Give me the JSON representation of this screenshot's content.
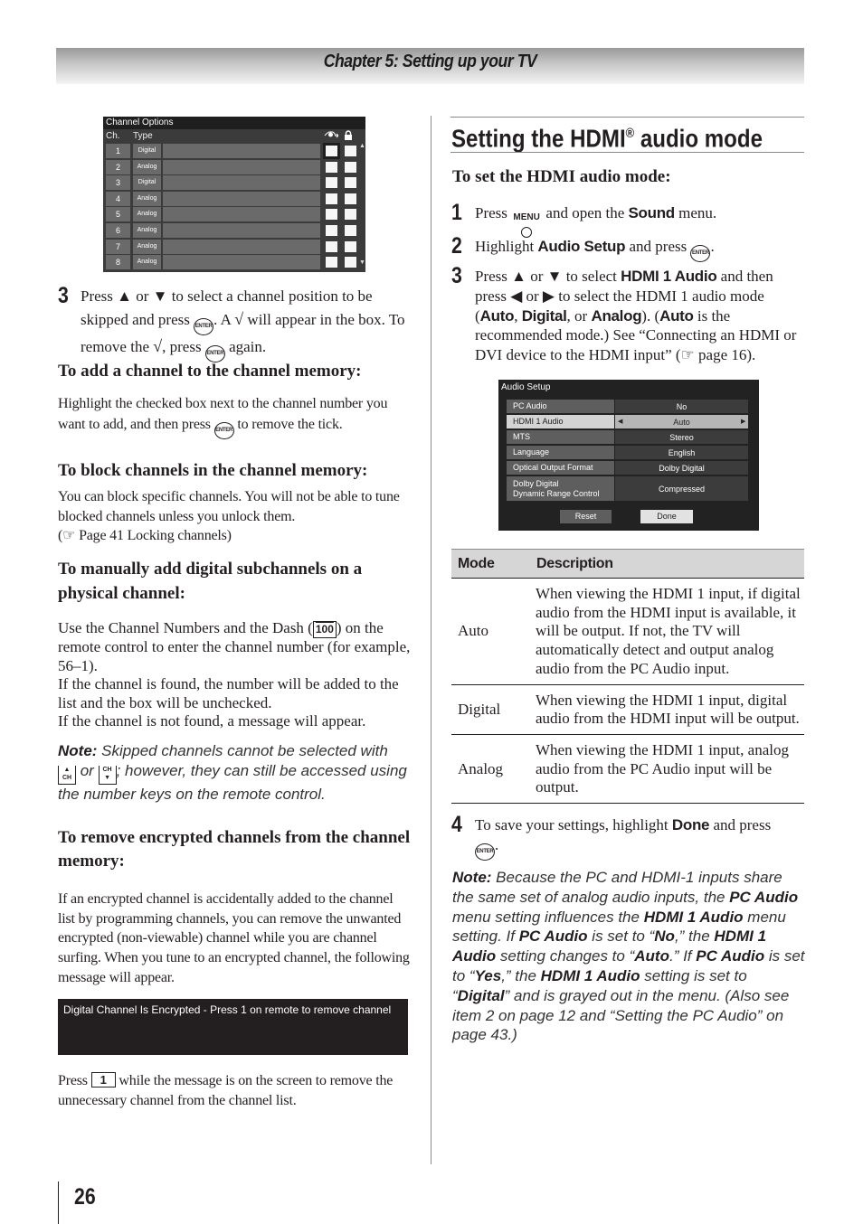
{
  "header": {
    "chapter_title": "Chapter 5: Setting up your TV"
  },
  "left": {
    "channel_options_screen": {
      "title": "Channel Options",
      "col_ch": "Ch.",
      "col_type": "Type",
      "skip_icon": "skip-eye-icon",
      "lock_icon": "lock-icon",
      "rows": [
        {
          "ch": "1",
          "type": "Digital",
          "skip_selected": true
        },
        {
          "ch": "2",
          "type": "Analog",
          "skip_selected": false
        },
        {
          "ch": "3",
          "type": "Digital",
          "skip_selected": false
        },
        {
          "ch": "4",
          "type": "Analog",
          "skip_selected": false
        },
        {
          "ch": "5",
          "type": "Analog",
          "skip_selected": false
        },
        {
          "ch": "6",
          "type": "Analog",
          "skip_selected": false
        },
        {
          "ch": "7",
          "type": "Analog",
          "skip_selected": false
        },
        {
          "ch": "8",
          "type": "Analog",
          "skip_selected": false
        }
      ],
      "scroll_up": "▲",
      "scroll_down": "▼"
    },
    "step3": {
      "num": "3",
      "p1": "Press ▲ or ▼ to select a channel position to be skipped and press ",
      "p2": ". A ",
      "p3": " will appear in the box. To remove the ",
      "p4": ", press ",
      "p5": " again.",
      "check": "√",
      "enter": "ENTER"
    },
    "add_heading": "To add a channel to the channel memory:",
    "add_body_1": "Highlight the checked box next to the channel number you want to add, and then press ",
    "add_body_2": " to remove the tick.",
    "block_heading": "To block channels in the channel memory:",
    "block_body": "You can block specific channels. You will not be able to tune blocked channels unless you unlock them.",
    "block_ref": "(☞ Page 41 Locking channels)",
    "manual_heading": "To manually add digital subchannels on a physical channel:",
    "manual_body_1": "Use the Channel Numbers and the Dash (",
    "dash_key": "100",
    "manual_body_2": ") on the remote control to enter the channel number (for example, 56–1).",
    "manual_body_3": "If the channel is found, the number will be added to the list and the box will be unchecked.",
    "manual_body_4": "If the channel is not found, a message will appear.",
    "note1_label": "Note:",
    "note1_1": " Skipped channels cannot be selected with ",
    "note1_or": " or ",
    "note1_2": "; however, they can still be accessed using the number keys on the remote control.",
    "ch_up_key": "CH",
    "ch_down_key": "CH",
    "remove_heading": "To remove encrypted channels from the channel memory:",
    "remove_body": "If an encrypted channel is accidentally added to the channel list by programming channels, you can remove the unwanted encrypted (non-viewable) channel while you are channel surfing. When you tune to an encrypted channel, the following message will appear.",
    "encrypted_message": "Digital Channel Is Encrypted - Press 1 on remote to remove channel",
    "press_1_a": "Press ",
    "key_1": "1",
    "press_1_b": " while the message is on the screen to remove the unnecessary channel from the channel list."
  },
  "right": {
    "section_title": "Setting the HDMI",
    "section_title_reg": "®",
    "section_title_end": " audio mode",
    "sub_heading": "To set the HDMI audio mode:",
    "step1": {
      "num": "1",
      "a": "Press ",
      "menu_key": "MENU",
      "b": " and open the ",
      "bold": "Sound",
      "c": " menu."
    },
    "step2": {
      "num": "2",
      "a": "Highlight ",
      "bold": "Audio Setup",
      "b": " and press ",
      "c": "."
    },
    "step3": {
      "num": "3",
      "a": "Press ▲ or ▼ to select ",
      "b1": "HDMI 1 Audio",
      "c": " and then press ◀ or ▶ to select the HDMI 1 audio mode (",
      "b2": "Auto",
      "d": ", ",
      "b3": "Digital",
      "e": ", or ",
      "b4": "Analog",
      "f": "). (",
      "b5": "Auto",
      "g": " is the recommended mode.) See “Connecting an HDMI or DVI device to the HDMI input” (☞ page 16)."
    },
    "audio_setup_screen": {
      "title": "Audio Setup",
      "rows": [
        {
          "label": "PC Audio",
          "value": "No",
          "highlighted": false
        },
        {
          "label": "HDMI 1 Audio",
          "value": "Auto",
          "highlighted": true
        },
        {
          "label": "MTS",
          "value": "Stereo",
          "highlighted": false
        },
        {
          "label": "Language",
          "value": "English",
          "highlighted": false
        },
        {
          "label": "Optical Output Format",
          "value": "Dolby Digital",
          "highlighted": false
        },
        {
          "label": "Dolby Digital\nDynamic Range Control",
          "value": "Compressed",
          "highlighted": false
        }
      ],
      "left_arrow": "◀",
      "right_arrow": "▶",
      "reset_label": "Reset",
      "done_label": "Done"
    },
    "mode_table": {
      "headers": [
        "Mode",
        "Description"
      ],
      "rows": [
        {
          "mode": "Auto",
          "description": "When viewing the HDMI 1 input, if digital audio from the HDMI input is available, it will be output. If not, the TV will automatically detect and output analog audio from the PC Audio input."
        },
        {
          "mode": "Digital",
          "description": "When viewing the HDMI 1 input, digital audio from the HDMI input will be output."
        },
        {
          "mode": "Analog",
          "description": "When viewing the HDMI 1 input, analog audio from the PC Audio input will be output."
        }
      ]
    },
    "step4": {
      "num": "4",
      "a": "To save your settings, highlight ",
      "bold": "Done",
      "b": " and press ",
      "c": "."
    },
    "note2": {
      "label": "Note:",
      "t1": " Because the PC and HDMI-1 inputs share the same set of analog audio inputs, the ",
      "b1": "PC Audio",
      "t2": " menu setting influences the ",
      "b2": "HDMI 1 Audio",
      "t3": " menu setting. If ",
      "b3": "PC Audio",
      "t4": " is set to “",
      "b4": "No",
      "t5": ",” the ",
      "b5": "HDMI 1 Audio",
      "t6": " setting changes to “",
      "b6": "Auto",
      "t7": ".” If ",
      "b7": "PC Audio",
      "t8": " is set to “",
      "b8": "Yes",
      "t9": ",” the ",
      "b9": "HDMI 1 Audio",
      "t10": " setting is set to “",
      "b10": "Digital",
      "t11": "” and is grayed out in the menu. (Also see item 2 on page 12 and “Setting the PC Audio” on page 43.)"
    }
  },
  "footer": {
    "page_number": "26"
  }
}
